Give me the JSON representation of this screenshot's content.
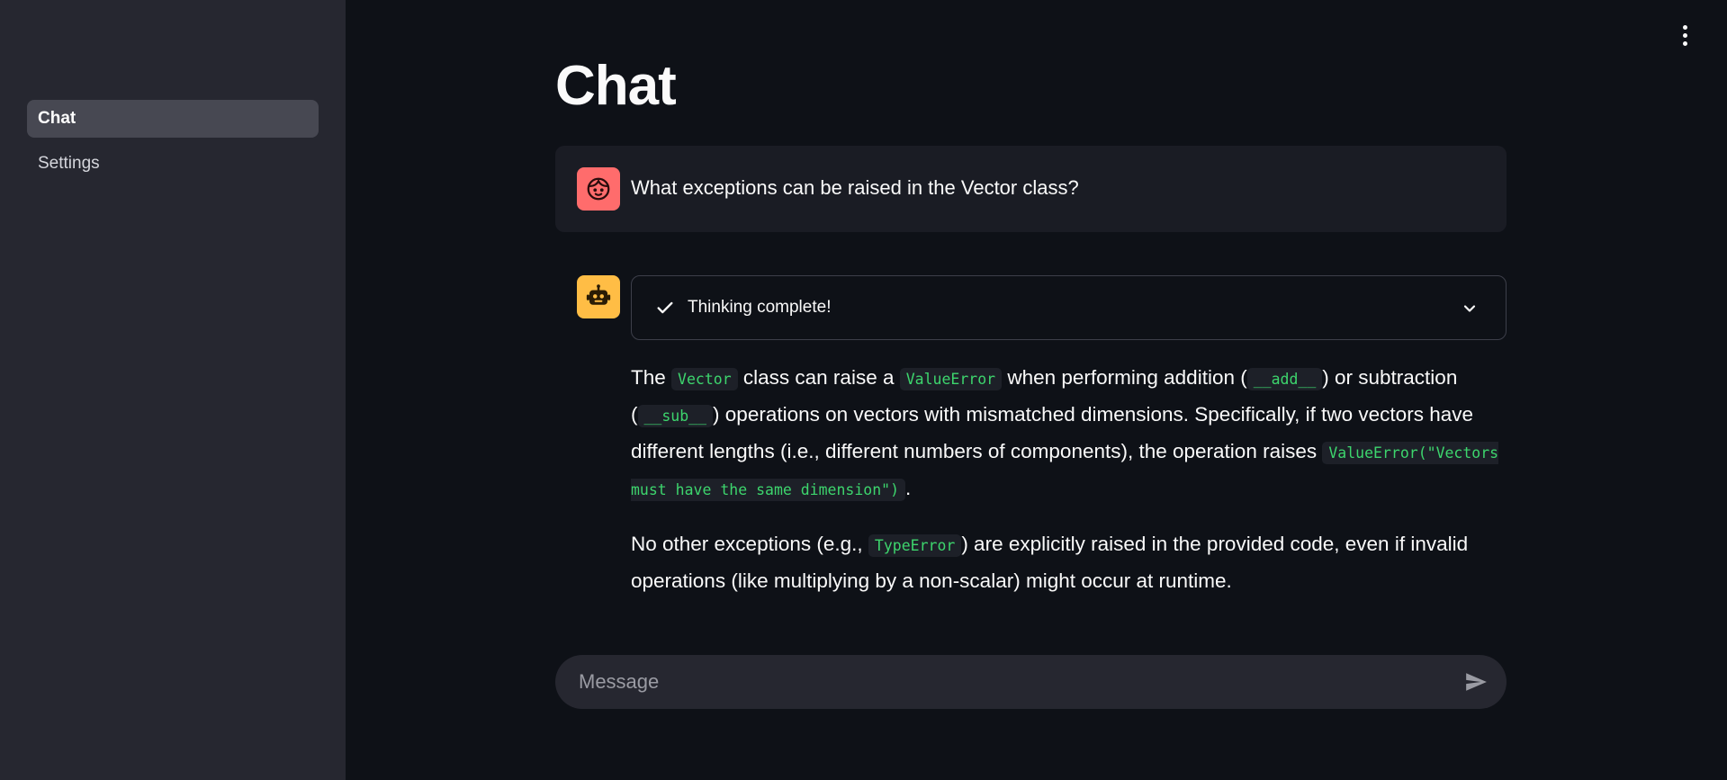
{
  "sidebar": {
    "items": [
      {
        "label": "Chat",
        "active": true
      },
      {
        "label": "Settings",
        "active": false
      }
    ]
  },
  "page": {
    "title": "Chat"
  },
  "icons": {
    "menu": "vertical-dots-icon",
    "user_avatar": "face-icon",
    "bot_avatar": "robot-icon",
    "check": "check-icon",
    "chevron": "chevron-down-icon",
    "send": "send-icon"
  },
  "colors": {
    "background": "#0e1117",
    "sidebar": "#262730",
    "user_avatar": "#ff6c6c",
    "bot_avatar": "#ffbd45",
    "code": "#3dd56d"
  },
  "messages": {
    "user": {
      "text": "What exceptions can be raised in the Vector class?"
    },
    "assistant": {
      "status_label": "Thinking complete!",
      "p1": {
        "t1": "The ",
        "c1": "Vector",
        "t2": " class can raise a ",
        "c2": "ValueError",
        "t3": " when performing addition (",
        "c3": "__add__",
        "t4": ") or subtraction (",
        "c4": "__sub__",
        "t5": ") operations on vectors with mismatched dimensions. Specifically, if two vectors have different lengths (i.e., different numbers of components), the operation raises ",
        "c5": "ValueError(\"Vectors must have the same dimension\")",
        "t6": "."
      },
      "p2": {
        "t1": "No other exceptions (e.g., ",
        "c1": "TypeError",
        "t2": ") are explicitly raised in the provided code, even if invalid operations (like multiplying by a non-scalar) might occur at runtime."
      }
    }
  },
  "chat_input": {
    "placeholder": "Message",
    "value": ""
  }
}
